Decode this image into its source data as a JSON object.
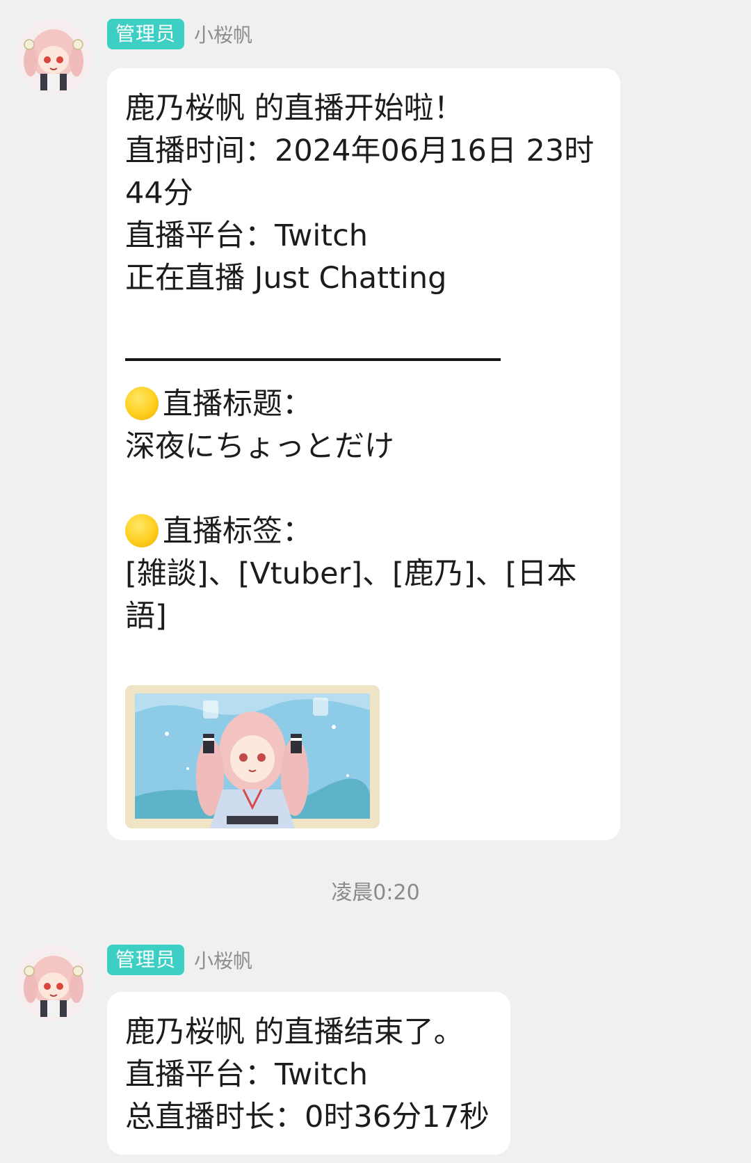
{
  "messages": [
    {
      "role_badge": "管理员",
      "sender": "小桜帆",
      "lines": [
        "鹿乃桜帆 的直播开始啦！",
        "直播时间：2024年06月16日 23时",
        "44分",
        "直播平台：Twitch",
        "正在直播 Just Chatting"
      ],
      "title_heading": "直播标题：",
      "title_value": "深夜にちょっとだけ",
      "tags_heading": "直播标签：",
      "tags_line1": "[雑談]、[Vtuber]、[鹿乃]、[日本",
      "tags_line2": "語]",
      "emoji": "yellow-circle-emoji"
    },
    {
      "role_badge": "管理员",
      "sender": "小桜帆",
      "lines": [
        "鹿乃桜帆 的直播结束了。",
        "直播平台：Twitch",
        "总直播时长：0时36分17秒"
      ]
    }
  ],
  "timestamp": "凌晨0:20",
  "colors": {
    "background": "#eef1ef",
    "badge": "#3ecfc4",
    "bubble": "#ffffff",
    "thumbnail_sky": "#8ecbe6"
  }
}
